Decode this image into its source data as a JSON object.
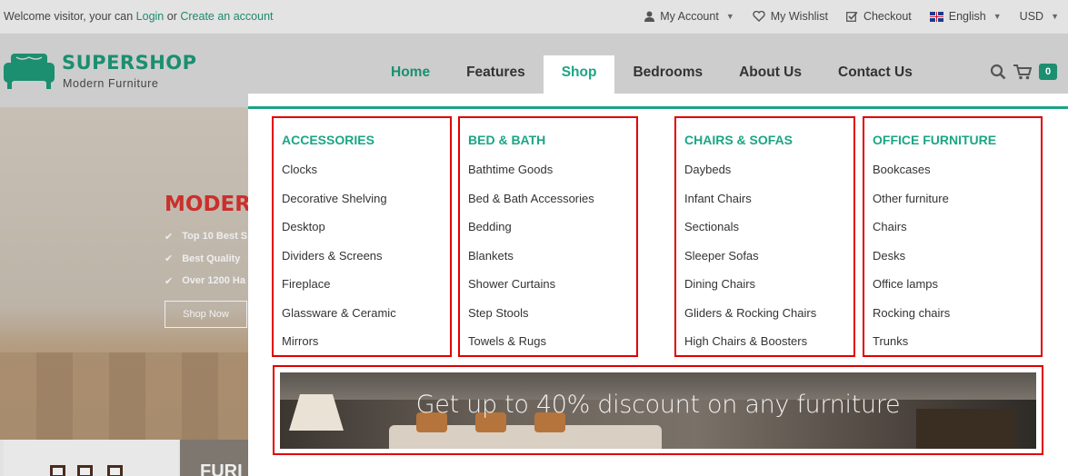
{
  "topbar": {
    "welcome_prefix": "Welcome visitor, your can",
    "login": "Login",
    "or": "or",
    "create_account": "Create an account",
    "my_account": "My Account",
    "my_wishlist": "My Wishlist",
    "checkout": "Checkout",
    "language": "English",
    "currency": "USD"
  },
  "logo": {
    "title": "SUPERSHOP",
    "subtitle": "Modern Furniture"
  },
  "nav": {
    "home": "Home",
    "features": "Features",
    "shop": "Shop",
    "bedrooms": "Bedrooms",
    "about": "About Us",
    "contact": "Contact Us"
  },
  "cart": {
    "count": "0"
  },
  "hero": {
    "title": "MODER",
    "bullets": [
      "Top 10 Best S",
      "Best Quality",
      "Over 1200 Ha"
    ],
    "button": "Shop Now",
    "bottom_text": "FURI"
  },
  "mega": {
    "columns": [
      {
        "title": "ACCESSORIES",
        "items": [
          "Clocks",
          "Decorative Shelving",
          "Desktop",
          "Dividers & Screens",
          "Fireplace",
          "Glassware & Ceramic",
          "Mirrors"
        ]
      },
      {
        "title": "BED & BATH",
        "items": [
          "Bathtime Goods",
          "Bed & Bath Accessories",
          "Bedding",
          "Blankets",
          "Shower Curtains",
          "Step Stools",
          "Towels & Rugs"
        ]
      },
      {
        "title": "CHAIRS & SOFAS",
        "items": [
          "Daybeds",
          "Infant Chairs",
          "Sectionals",
          "Sleeper Sofas",
          "Dining Chairs",
          "Gliders & Rocking Chairs",
          "High Chairs & Boosters"
        ]
      },
      {
        "title": "OFFICE FURNITURE",
        "items": [
          "Bookcases",
          "Other furniture",
          "Chairs",
          "Desks",
          "Office lamps",
          "Rocking chairs",
          "Trunks"
        ]
      }
    ],
    "banner_text": "Get up to 40% discount on any furniture"
  },
  "colors": {
    "accent": "#1ba585",
    "brand": "#1b8f70",
    "highlight_border": "#e00000"
  }
}
